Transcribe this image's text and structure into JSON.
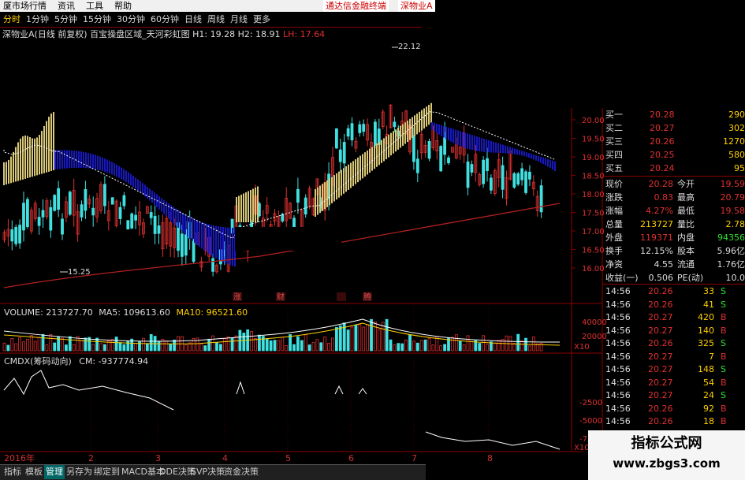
{
  "menu": [
    "厦市场行情",
    "资讯",
    "工具",
    "帮助"
  ],
  "tags": [
    "通达信金融终端",
    "深物业A"
  ],
  "periods": [
    "分时",
    "1分钟",
    "5分钟",
    "15分钟",
    "30分钟",
    "60分钟",
    "日线",
    "周线",
    "月线",
    "更多"
  ],
  "kinfo": {
    "name": "深物业A(日线 前复权)",
    "indicator": "百宝操盘区域_天河彩虹图",
    "h1": "H1: 19.28",
    "h2": "H2: 18.91",
    "lh": "LH: 17.64"
  },
  "annotations": {
    "high": "22.12",
    "low": "15.25",
    "events": [
      "涨",
      "财",
      "",
      "腾"
    ]
  },
  "price_axis": [
    "20.00",
    "19.50",
    "19.00",
    "18.50",
    "18.00",
    "17.50",
    "17.00",
    "16.50",
    "16.00"
  ],
  "volume": {
    "label": "VOLUME: 213727.70",
    "ma5": "MA5: 109613.60",
    "ma10": "MA10: 96521.60",
    "ticks": [
      "40000",
      "20000",
      "X10"
    ]
  },
  "cmd": {
    "label": "CMDX(筹码动向)",
    "cm": "CM: -937774.94",
    "ticks": [
      "-2500",
      "-5000",
      "-7500",
      "X10"
    ]
  },
  "dates": [
    "2016年",
    "2",
    "3",
    "4",
    "5",
    "6",
    "7",
    "8"
  ],
  "tabs": [
    "指标",
    "模板",
    "管理",
    "另存为",
    "绑定到",
    "MACD基本",
    "DDE决策",
    "SVP决策",
    "资金决策"
  ],
  "active_tab": "管理",
  "quote": {
    "bids": [
      {
        "label": "买一",
        "price": "20.28",
        "vol": "290"
      },
      {
        "label": "买二",
        "price": "20.27",
        "vol": "302"
      },
      {
        "label": "买三",
        "price": "20.26",
        "vol": "1270"
      },
      {
        "label": "买四",
        "price": "20.25",
        "vol": "580"
      },
      {
        "label": "买五",
        "price": "20.24",
        "vol": "95"
      }
    ],
    "stats": [
      {
        "l1": "现价",
        "v1": "20.28",
        "l2": "今开",
        "v2": "19.59"
      },
      {
        "l1": "涨跌",
        "v1": "0.83",
        "l2": "最高",
        "v2": "20.79"
      },
      {
        "l1": "涨幅",
        "v1": "4.27%",
        "l2": "最低",
        "v2": "19.58"
      },
      {
        "l1": "总量",
        "v1": "213727",
        "l2": "量比",
        "v2": "2.78"
      },
      {
        "l1": "外盘",
        "v1": "119371",
        "l2": "内盘",
        "v2": "94356"
      },
      {
        "l1": "换手",
        "v1": "12.15%",
        "l2": "股本",
        "v2": "5.96亿"
      },
      {
        "l1": "净资",
        "v1": "4.55",
        "l2": "流通",
        "v2": "1.76亿"
      },
      {
        "l1": "收益(一)",
        "v1": "0.506",
        "l2": "PE(动)",
        "v2": "10.0"
      }
    ],
    "ticks": [
      {
        "t": "14:56",
        "p": "20.26",
        "v": "33",
        "s": "S"
      },
      {
        "t": "14:56",
        "p": "20.26",
        "v": "41",
        "s": "S"
      },
      {
        "t": "14:56",
        "p": "20.27",
        "v": "420",
        "s": "B"
      },
      {
        "t": "14:56",
        "p": "20.27",
        "v": "140",
        "s": "B"
      },
      {
        "t": "14:56",
        "p": "20.26",
        "v": "325",
        "s": "S"
      },
      {
        "t": "14:56",
        "p": "20.27",
        "v": "7",
        "s": "B"
      },
      {
        "t": "14:56",
        "p": "20.27",
        "v": "148",
        "s": "S"
      },
      {
        "t": "14:56",
        "p": "20.27",
        "v": "54",
        "s": "B"
      },
      {
        "t": "14:56",
        "p": "20.27",
        "v": "24",
        "s": "S"
      },
      {
        "t": "14:56",
        "p": "20.26",
        "v": "92",
        "s": "B"
      },
      {
        "t": "14:56",
        "p": "20.26",
        "v": "18",
        "s": "B"
      },
      {
        "t": "14:56",
        "p": "20.27",
        "v": "11",
        "s": "B"
      }
    ]
  },
  "watermark": {
    "line1": "指标公式网",
    "line2": "www.zbgs3.com"
  },
  "colors": {
    "up": "#e03030",
    "down": "#40e0e0",
    "gold": "#d8c878",
    "blue": "#1818c0",
    "yellow": "#ffd000"
  }
}
